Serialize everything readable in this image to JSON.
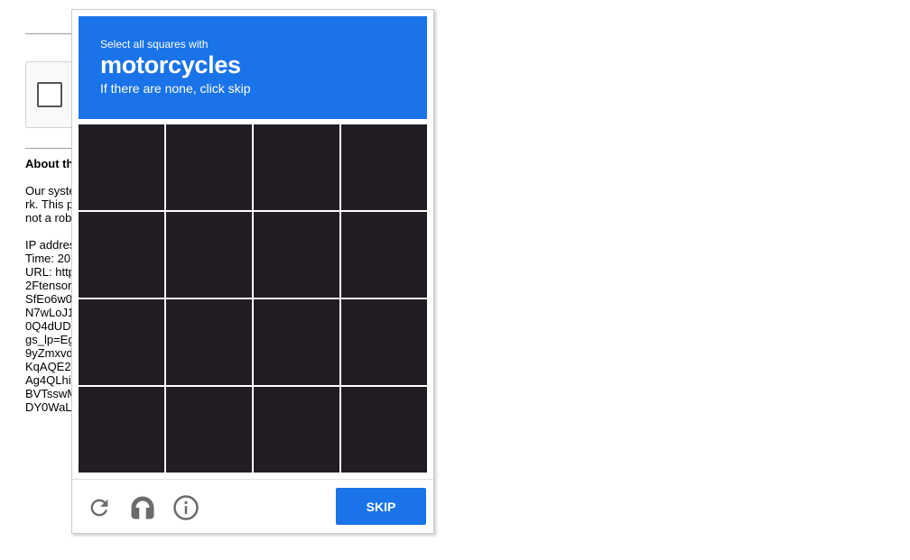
{
  "background": {
    "heading": "About th",
    "lines": [
      "Our syste",
      "rk. This p",
      "not a rob",
      "",
      "IP addres",
      "Time: 20",
      "URL: http",
      "2Ftensor",
      "SfEo6w0",
      "N7wLoJ1",
      "0Q4dUD",
      "gs_lp=Eg",
      "9yZmxvd",
      "KqAQE2",
      "Ag4QLhi",
      "BVTsswM",
      "DY0WaL"
    ]
  },
  "challenge": {
    "prompt": {
      "lead": "Select all squares with",
      "keyword": "motorcycles",
      "sub": "If there are none, click skip"
    },
    "grid": {
      "rows": 4,
      "cols": 4
    },
    "footer": {
      "reload_icon": "reload-icon",
      "audio_icon": "headphones-icon",
      "info_icon": "info-icon",
      "skip_label": "SKIP"
    },
    "colors": {
      "accent": "#1a73e8",
      "icon": "#6b6b6b"
    }
  }
}
